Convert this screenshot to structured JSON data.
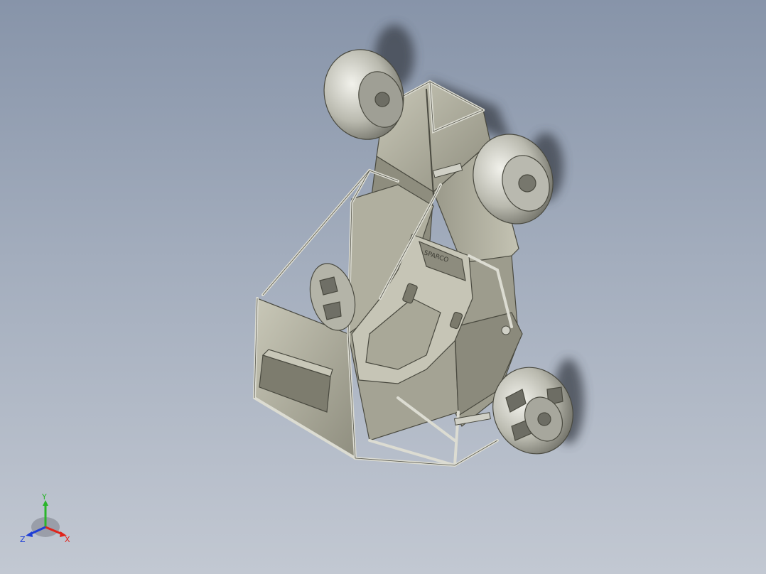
{
  "viewport": {
    "background_top": "#8794a9",
    "background_bottom": "#c2c8d2"
  },
  "model": {
    "body_color": "#a9a897",
    "tire_color": "#c9c9bf",
    "frame_color": "#d6d6cc",
    "seat_logo_text": "SPARCO"
  },
  "triad": {
    "x_label": "X",
    "y_label": "Y",
    "z_label": "Z",
    "x_color": "#e0241b",
    "y_color": "#2bb52b",
    "z_color": "#1f3fd6"
  }
}
